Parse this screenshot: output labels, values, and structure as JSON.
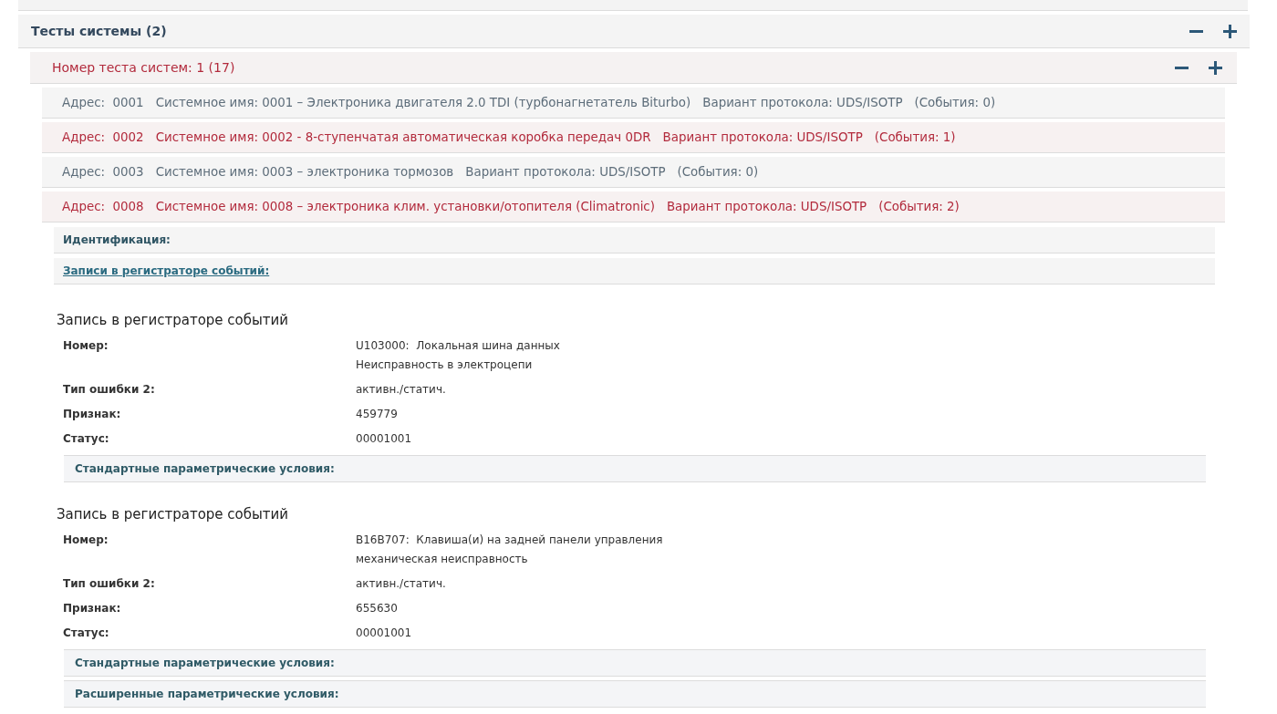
{
  "group": {
    "title": "Тесты системы (2)",
    "expanded": true
  },
  "test": {
    "title": "Номер теста систем: 1 (17)",
    "error": true
  },
  "systems": [
    {
      "address": "Адрес:  0001",
      "name": "Системное имя: 0001 – Электроника двигателя 2.0 TDI (турбонагнетатель Biturbo)",
      "protocol": "Вариант протокола: UDS/ISOTP",
      "events": "(События: 0)",
      "error": false
    },
    {
      "address": "Адрес:  0002",
      "name": "Системное имя: 0002 - 8-ступенчатая автоматическая коробка передач 0DR",
      "protocol": "Вариант протокола: UDS/ISOTP",
      "events": "(События: 1)",
      "error": true
    },
    {
      "address": "Адрес:  0003",
      "name": "Системное имя: 0003 – электроника тормозов",
      "protocol": "Вариант протокола: UDS/ISOTP",
      "events": "(События: 0)",
      "error": false
    },
    {
      "address": "Адрес:  0008",
      "name": "Системное имя: 0008 – электроника клим. установки/отопителя (Climatronic)",
      "protocol": "Вариант протокола: UDS/ISOTP",
      "events": "(События: 2)",
      "error": true
    }
  ],
  "subsections": [
    {
      "label": "Идентификация:",
      "kind": "heading"
    },
    {
      "label": "Записи в регистраторе событий:",
      "kind": "link"
    }
  ],
  "records": [
    {
      "title": "Запись в регистраторе событий",
      "fields": [
        {
          "label": "Номер:",
          "value": [
            "U103000:  Локальная шина данных",
            "Неисправность в электроцепи"
          ]
        },
        {
          "label": "Тип ошибки 2:",
          "value": [
            "активн./статич."
          ]
        },
        {
          "label": "Признак:",
          "value": [
            "459779"
          ]
        },
        {
          "label": "Статус:",
          "value": [
            "00001001"
          ]
        }
      ],
      "sections": [
        "Стандартные параметрические условия:"
      ]
    },
    {
      "title": "Запись в регистраторе событий",
      "fields": [
        {
          "label": "Номер:",
          "value": [
            "B16B707:  Клавиша(и) на задней панели управления",
            "механическая неисправность"
          ]
        },
        {
          "label": "Тип ошибки 2:",
          "value": [
            "активн./статич."
          ]
        },
        {
          "label": "Признак:",
          "value": [
            "655630"
          ]
        },
        {
          "label": "Статус:",
          "value": [
            "00001001"
          ]
        }
      ],
      "sections": [
        "Стандартные параметрические условия:",
        "Расширенные параметрические условия:"
      ]
    }
  ]
}
